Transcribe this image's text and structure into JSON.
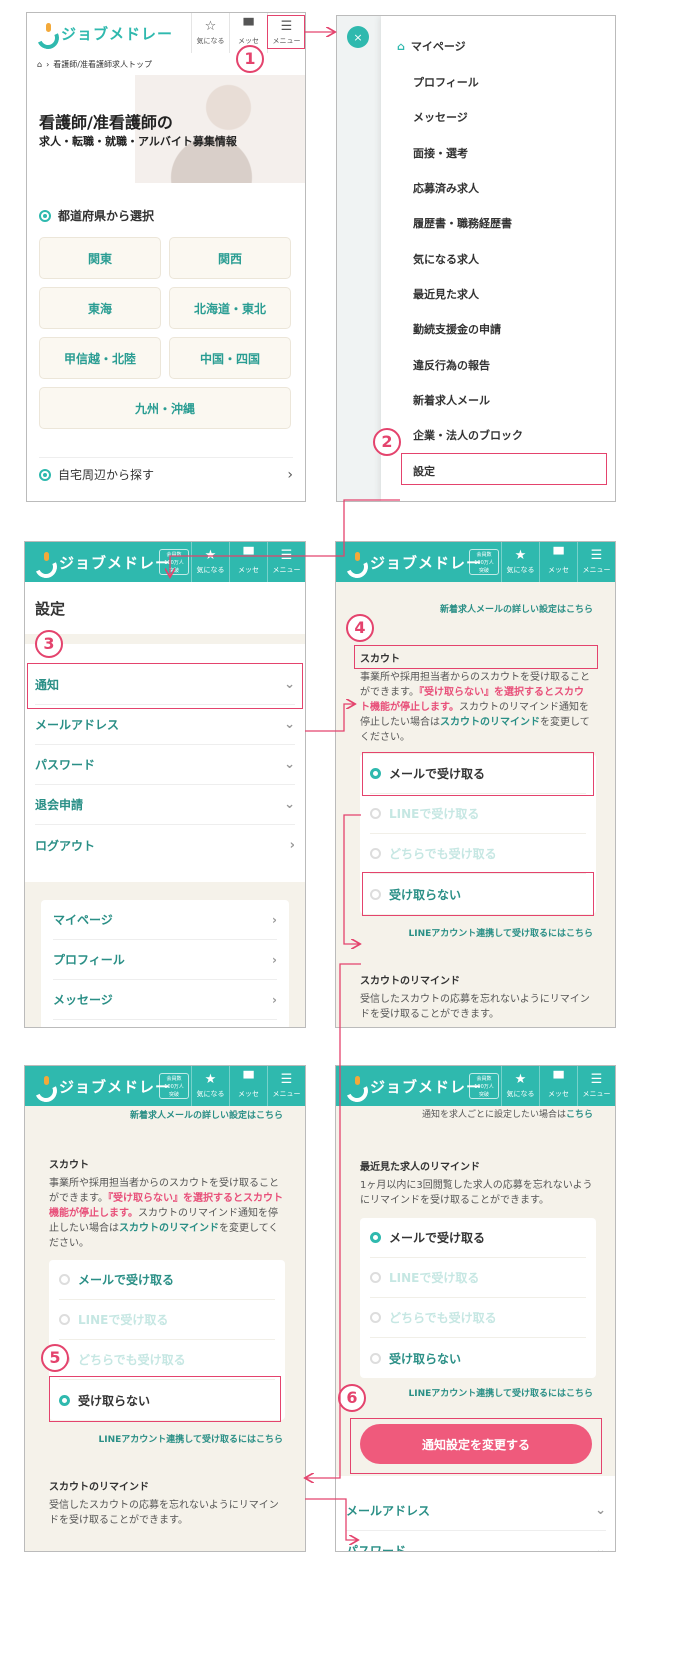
{
  "logo": "ジョブメドレー",
  "badge": [
    "会員数",
    "100万人",
    "突破"
  ],
  "header": {
    "fav": "気になる",
    "msg": "メッセ",
    "menu": "メニュー"
  },
  "breadcrumb": "看護師/准看護師求人トップ",
  "hero": {
    "title": "看護師/准看護師の",
    "subtitle": "求人・転職・就職・アルバイト募集情報"
  },
  "regions_title": "都道府県から選択",
  "regions": [
    "関東",
    "関西",
    "東海",
    "北海道・東北",
    "甲信越・北陸",
    "中国・四国",
    "九州・沖縄"
  ],
  "nearby": "自宅周辺から探す",
  "menu": [
    "マイページ",
    "プロフィール",
    "メッセージ",
    "面接・選考",
    "応募済み求人",
    "履歴書・職務経歴書",
    "気になる求人",
    "最近見た求人",
    "勤続支援金の申請",
    "違反行為の報告",
    "新着求人メール",
    "企業・法人のブロック",
    "設定"
  ],
  "settings": {
    "title": "設定",
    "items": [
      "通知",
      "メールアドレス",
      "パスワード",
      "退会申請",
      "ログアウト"
    ],
    "links": [
      "マイページ",
      "プロフィール",
      "メッセージ"
    ]
  },
  "scout": {
    "top_link": "新着求人メールの詳しい設定はこちら",
    "title": "スカウト",
    "p1": "事業所や採用担当者からのスカウトを受け取ることができます。",
    "p_red": "『受け取らない』を選択するとスカウト機能が停止します。",
    "p2": "スカウトのリマインド通知を停止したい場合は",
    "p_link": "スカウトのリマインド",
    "p3": "を変更してください。",
    "options": [
      "メールで受け取る",
      "LINEで受け取る",
      "どちらでも受け取る",
      "受け取らない"
    ],
    "line_link": "LINEアカウント連携して受け取るにはこちら",
    "remind_title": "スカウトのリマインド",
    "remind_text": "受信したスカウトの応募を忘れないようにリマインドを受け取ることができます。"
  },
  "recent": {
    "top_text": "通知を求人ごとに設定したい場合は",
    "top_link": "こちら",
    "title": "最近見た求人のリマインド",
    "text": "1ヶ月以内に3回閲覧した求人の応募を忘れないようにリマインドを受け取ることができます。",
    "cta": "通知設定を変更する",
    "after": [
      "メールアドレス",
      "パスワード"
    ]
  },
  "steps": [
    "1",
    "2",
    "3",
    "4",
    "5",
    "6"
  ],
  "colors": {
    "teal": "#2fb9ae",
    "pink": "#e4436d",
    "cta": "#ef5a7c"
  }
}
